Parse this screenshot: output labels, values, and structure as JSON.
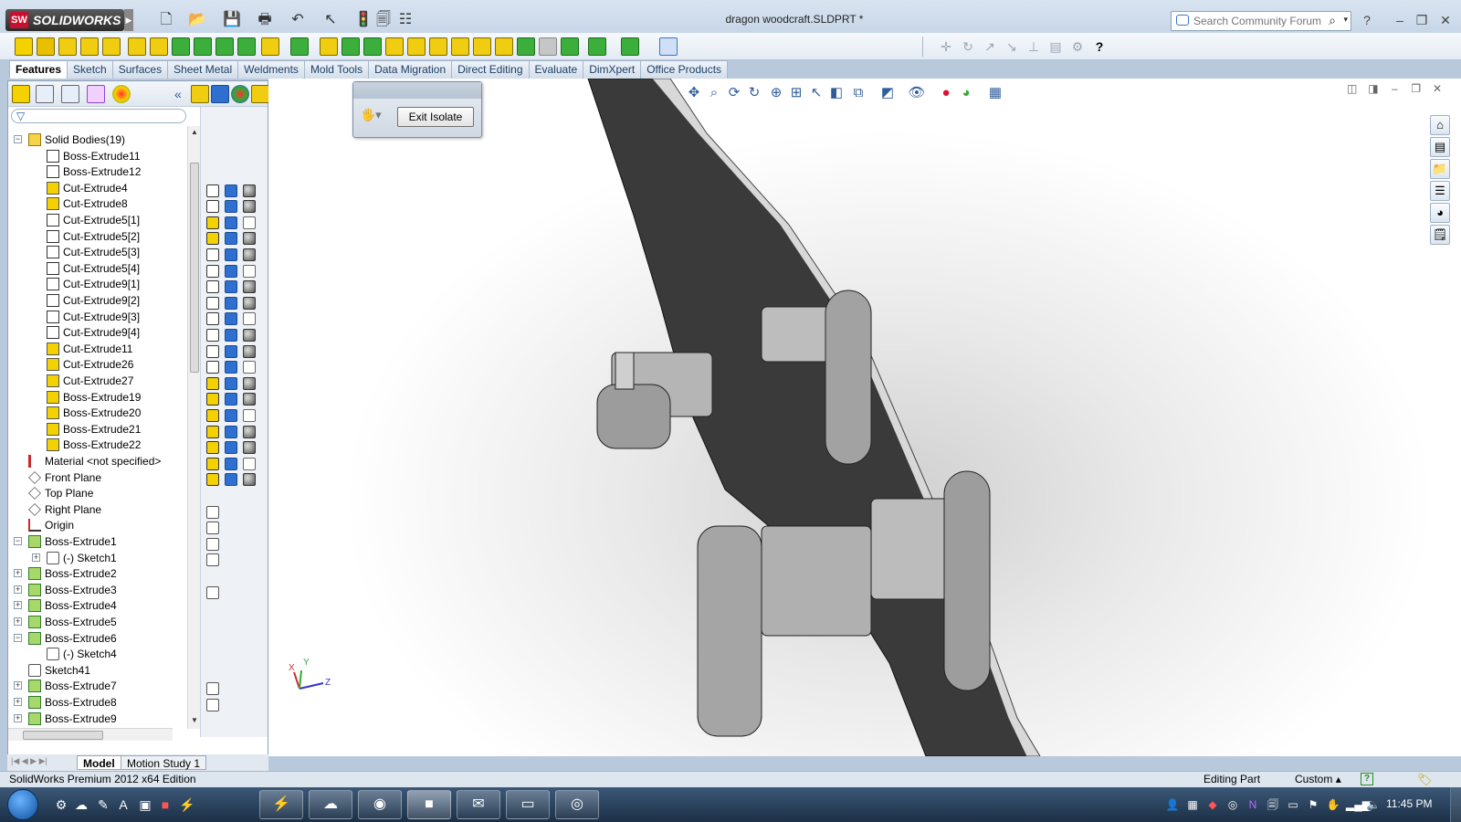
{
  "app": {
    "logo_text": "SOLIDWORKS",
    "logo_badge": "SW",
    "document_title": "dragon woodcraft.SLDPRT *"
  },
  "search": {
    "placeholder": "Search Community Forum"
  },
  "tabs": [
    {
      "label": "Features",
      "active": true
    },
    {
      "label": "Sketch"
    },
    {
      "label": "Surfaces"
    },
    {
      "label": "Sheet Metal"
    },
    {
      "label": "Weldments"
    },
    {
      "label": "Mold Tools"
    },
    {
      "label": "Data Migration"
    },
    {
      "label": "Direct Editing"
    },
    {
      "label": "Evaluate"
    },
    {
      "label": "DimXpert"
    },
    {
      "label": "Office Products"
    }
  ],
  "isolate": {
    "exit_label": "Exit Isolate"
  },
  "tree": [
    {
      "label": "Solid Bodies(19)",
      "icon": "folder-icon",
      "level": 0,
      "exp": "−"
    },
    {
      "label": "Boss-Extrude11",
      "icon": "body-icon",
      "level": 1
    },
    {
      "label": "Boss-Extrude12",
      "icon": "body-icon",
      "level": 1
    },
    {
      "label": "Cut-Extrude4",
      "icon": "body-selected-icon",
      "level": 1
    },
    {
      "label": "Cut-Extrude8",
      "icon": "body-selected-icon",
      "level": 1
    },
    {
      "label": "Cut-Extrude5[1]",
      "icon": "body-icon",
      "level": 1
    },
    {
      "label": "Cut-Extrude5[2]",
      "icon": "body-icon",
      "level": 1
    },
    {
      "label": "Cut-Extrude5[3]",
      "icon": "body-icon",
      "level": 1
    },
    {
      "label": "Cut-Extrude5[4]",
      "icon": "body-icon",
      "level": 1
    },
    {
      "label": "Cut-Extrude9[1]",
      "icon": "body-icon",
      "level": 1
    },
    {
      "label": "Cut-Extrude9[2]",
      "icon": "body-icon",
      "level": 1
    },
    {
      "label": "Cut-Extrude9[3]",
      "icon": "body-icon",
      "level": 1
    },
    {
      "label": "Cut-Extrude9[4]",
      "icon": "body-icon",
      "level": 1
    },
    {
      "label": "Cut-Extrude11",
      "icon": "body-selected-icon",
      "level": 1
    },
    {
      "label": "Cut-Extrude26",
      "icon": "body-selected-icon",
      "level": 1
    },
    {
      "label": "Cut-Extrude27",
      "icon": "body-selected-icon",
      "level": 1
    },
    {
      "label": "Boss-Extrude19",
      "icon": "body-selected-icon",
      "level": 1
    },
    {
      "label": "Boss-Extrude20",
      "icon": "body-selected-icon",
      "level": 1
    },
    {
      "label": "Boss-Extrude21",
      "icon": "body-selected-icon",
      "level": 1
    },
    {
      "label": "Boss-Extrude22",
      "icon": "body-selected-icon",
      "level": 1
    },
    {
      "label": "Material <not specified>",
      "icon": "material-icon",
      "level": 0
    },
    {
      "label": "Front Plane",
      "icon": "plane-icon",
      "level": 0
    },
    {
      "label": "Top Plane",
      "icon": "plane-icon",
      "level": 0
    },
    {
      "label": "Right Plane",
      "icon": "plane-icon",
      "level": 0
    },
    {
      "label": "Origin",
      "icon": "origin-icon",
      "level": 0
    },
    {
      "label": "Boss-Extrude1",
      "icon": "feature-icon",
      "level": 0,
      "exp": "−"
    },
    {
      "label": "(-) Sketch1",
      "icon": "sketch-icon",
      "level": 1,
      "exp": "+"
    },
    {
      "label": "Boss-Extrude2",
      "icon": "feature-icon",
      "level": 0,
      "exp": "+"
    },
    {
      "label": "Boss-Extrude3",
      "icon": "feature-icon",
      "level": 0,
      "exp": "+"
    },
    {
      "label": "Boss-Extrude4",
      "icon": "feature-icon",
      "level": 0,
      "exp": "+"
    },
    {
      "label": "Boss-Extrude5",
      "icon": "feature-icon",
      "level": 0,
      "exp": "+"
    },
    {
      "label": "Boss-Extrude6",
      "icon": "feature-icon",
      "level": 0,
      "exp": "−"
    },
    {
      "label": "(-) Sketch4",
      "icon": "sketch-icon",
      "level": 1
    },
    {
      "label": "Sketch41",
      "icon": "sketch-icon",
      "level": 0
    },
    {
      "label": "Boss-Extrude7",
      "icon": "feature-icon",
      "level": 0,
      "exp": "+"
    },
    {
      "label": "Boss-Extrude8",
      "icon": "feature-icon",
      "level": 0,
      "exp": "+"
    },
    {
      "label": "Boss-Extrude9",
      "icon": "feature-icon",
      "level": 0,
      "exp": "+"
    }
  ],
  "bottom_tabs": [
    {
      "label": "Model",
      "active": true
    },
    {
      "label": "Motion Study 1"
    }
  ],
  "status": {
    "edition": "SolidWorks Premium 2012 x64 Edition",
    "mode": "Editing Part",
    "units": "Custom",
    "units_arrow": "▴",
    "help_icon": "?"
  },
  "triad": {
    "x": "X",
    "y": "Y",
    "z": "Z"
  },
  "taskbar": {
    "clock": "11:45 PM"
  },
  "colors": {
    "accent": "#2f6fd0",
    "body_selected": "#f3d200",
    "part_dark": "#3a3a3a",
    "part_light": "#a9a9a9"
  }
}
